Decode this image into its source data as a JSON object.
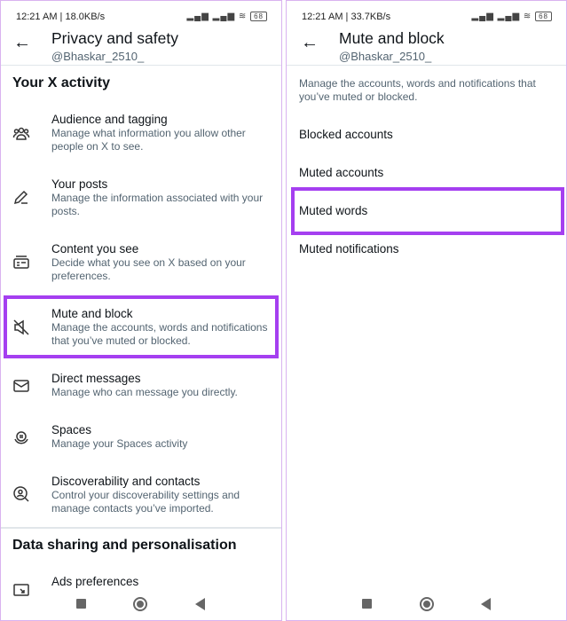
{
  "left": {
    "status": {
      "time_speed": "12:21 AM | 18.0KB/s",
      "battery": "68"
    },
    "header": {
      "title": "Privacy and safety",
      "handle": "@Bhaskar_2510_"
    },
    "section1": "Your X activity",
    "items": [
      {
        "title": "Audience and tagging",
        "desc": "Manage what information you allow other people on X to see.",
        "icon": "people-icon"
      },
      {
        "title": "Your posts",
        "desc": "Manage the information associated with your posts.",
        "icon": "pencil-icon"
      },
      {
        "title": "Content you see",
        "desc": "Decide what you see on X based on your preferences.",
        "icon": "content-icon"
      },
      {
        "title": "Mute and block",
        "desc": "Manage the accounts, words and notifications that you’ve muted or blocked.",
        "icon": "mute-icon"
      },
      {
        "title": "Direct messages",
        "desc": "Manage who can message you directly.",
        "icon": "envelope-icon"
      },
      {
        "title": "Spaces",
        "desc": "Manage your Spaces activity",
        "icon": "spaces-icon"
      },
      {
        "title": "Discoverability and contacts",
        "desc": "Control your discoverability settings and manage contacts you’ve imported.",
        "icon": "search-person-icon"
      }
    ],
    "section2": "Data sharing and personalisation",
    "ads": "Ads preferences"
  },
  "right": {
    "status": {
      "time_speed": "12:21 AM | 33.7KB/s",
      "battery": "68"
    },
    "header": {
      "title": "Mute and block",
      "handle": "@Bhaskar_2510_"
    },
    "desc": "Manage the accounts, words and notifications that you’ve muted or blocked.",
    "items": [
      "Blocked accounts",
      "Muted accounts",
      "Muted words",
      "Muted notifications"
    ]
  },
  "highlight_color": "#a53ff0"
}
